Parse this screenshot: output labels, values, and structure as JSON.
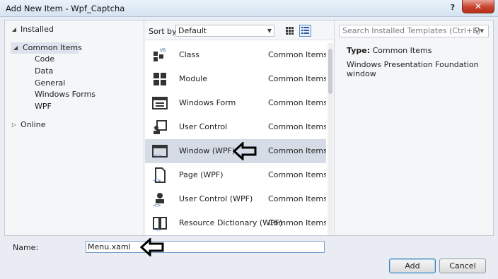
{
  "window": {
    "title": "Add New Item - Wpf_Captcha",
    "help_label": "?",
    "close_label": "✕"
  },
  "tree": {
    "installed_label": "Installed",
    "common_items_label": "Common Items",
    "children": [
      "Code",
      "Data",
      "General",
      "Windows Forms",
      "WPF"
    ],
    "online_label": "Online"
  },
  "sortbar": {
    "sort_label": "Sort by:",
    "sort_value": "Default"
  },
  "templates": [
    {
      "name": "Class",
      "category": "Common Items",
      "icon": "class-icon"
    },
    {
      "name": "Module",
      "category": "Common Items",
      "icon": "module-icon"
    },
    {
      "name": "Windows Form",
      "category": "Common Items",
      "icon": "windows-form-icon"
    },
    {
      "name": "User Control",
      "category": "Common Items",
      "icon": "user-control-icon"
    },
    {
      "name": "Window (WPF)",
      "category": "Common Items",
      "icon": "wpf-window-icon",
      "selected": true
    },
    {
      "name": "Page (WPF)",
      "category": "Common Items",
      "icon": "wpf-page-icon"
    },
    {
      "name": "User Control (WPF)",
      "category": "Common Items",
      "icon": "wpf-user-control-icon"
    },
    {
      "name": "Resource Dictionary (WPF)",
      "category": "Common Items",
      "icon": "resource-dictionary-icon"
    }
  ],
  "details": {
    "search_placeholder": "Search Installed Templates (Ctrl+E)",
    "type_label": "Type:",
    "type_value": "Common Items",
    "description": "Windows Presentation Foundation window"
  },
  "footer": {
    "name_label": "Name:",
    "name_value": "Menu.xaml",
    "add_label": "Add",
    "cancel_label": "Cancel"
  },
  "colors": {
    "selection": "#d6dce6",
    "annotation_arrow": "#000000",
    "close_red": "#c7432e"
  }
}
